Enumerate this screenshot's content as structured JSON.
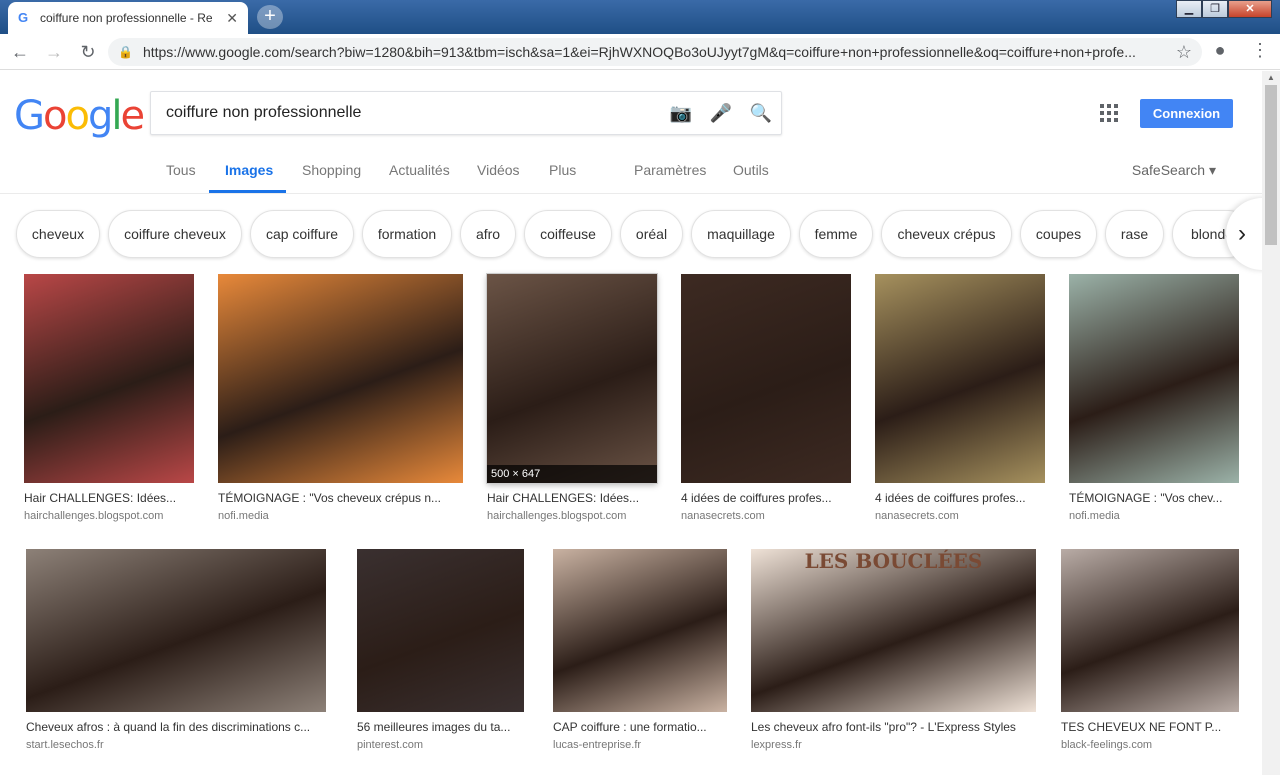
{
  "browser": {
    "tab_title": "coiffure non professionnelle - Re",
    "tab_close": "✕",
    "new_tab": "+",
    "url": "https://www.google.com/search?biw=1280&bih=913&tbm=isch&sa=1&ei=RjhWXNOQBo3oUJyyt7gM&q=coiffure+non+professionnelle&oq=coiffure+non+profe..."
  },
  "search": {
    "query": "coiffure non professionnelle",
    "sign_in": "Connexion"
  },
  "nav": {
    "tabs": [
      "Tous",
      "Images",
      "Shopping",
      "Actualités",
      "Vidéos",
      "Plus",
      "Paramètres",
      "Outils"
    ],
    "active": "Images",
    "safesearch": "SafeSearch ▾"
  },
  "chips": [
    "cheveux",
    "coiffure cheveux",
    "cap coiffure",
    "formation",
    "afro",
    "coiffeuse",
    "oréal",
    "maquillage",
    "femme",
    "cheveux crépus",
    "coupes",
    "rase",
    "blonde"
  ],
  "results_row1": [
    {
      "caption": "Hair CHALLENGES: Idées...",
      "source": "hairchallenges.blogspot.com",
      "color": "#b94747"
    },
    {
      "caption": "TÉMOIGNAGE : \"Vos cheveux crépus n...",
      "source": "nofi.media",
      "color": "#e8893a"
    },
    {
      "caption": "Hair CHALLENGES: Idées...",
      "source": "hairchallenges.blogspot.com",
      "color": "#6b5446",
      "dims": "500 × 647"
    },
    {
      "caption": "4 idées de coiffures profes...",
      "source": "nanasecrets.com",
      "color": "#3d2a22"
    },
    {
      "caption": "4 idées de coiffures profes...",
      "source": "nanasecrets.com",
      "color": "#a6915e"
    },
    {
      "caption": "TÉMOIGNAGE : \"Vos chev...",
      "source": "nofi.media",
      "color": "#9bb2a8"
    }
  ],
  "results_row2": [
    {
      "caption": "Cheveux afros : à quand la fin des discriminations c...",
      "source": "start.lesechos.fr",
      "color": "#8d8178"
    },
    {
      "caption": "56 meilleures images du ta...",
      "source": "pinterest.com",
      "color": "#3a3030"
    },
    {
      "caption": "CAP coiffure : une formatio...",
      "source": "lucas-entreprise.fr",
      "color": "#c9b2a2"
    },
    {
      "caption": "Les cheveux afro font-ils \"pro\"? - L'Express Styles",
      "source": "lexpress.fr",
      "color": "#efe2d7",
      "overlay_title": "LES BOUCLÉES"
    },
    {
      "caption": "TES CHEVEUX NE FONT P...",
      "source": "black-feelings.com",
      "color": "#b9aca6"
    }
  ]
}
